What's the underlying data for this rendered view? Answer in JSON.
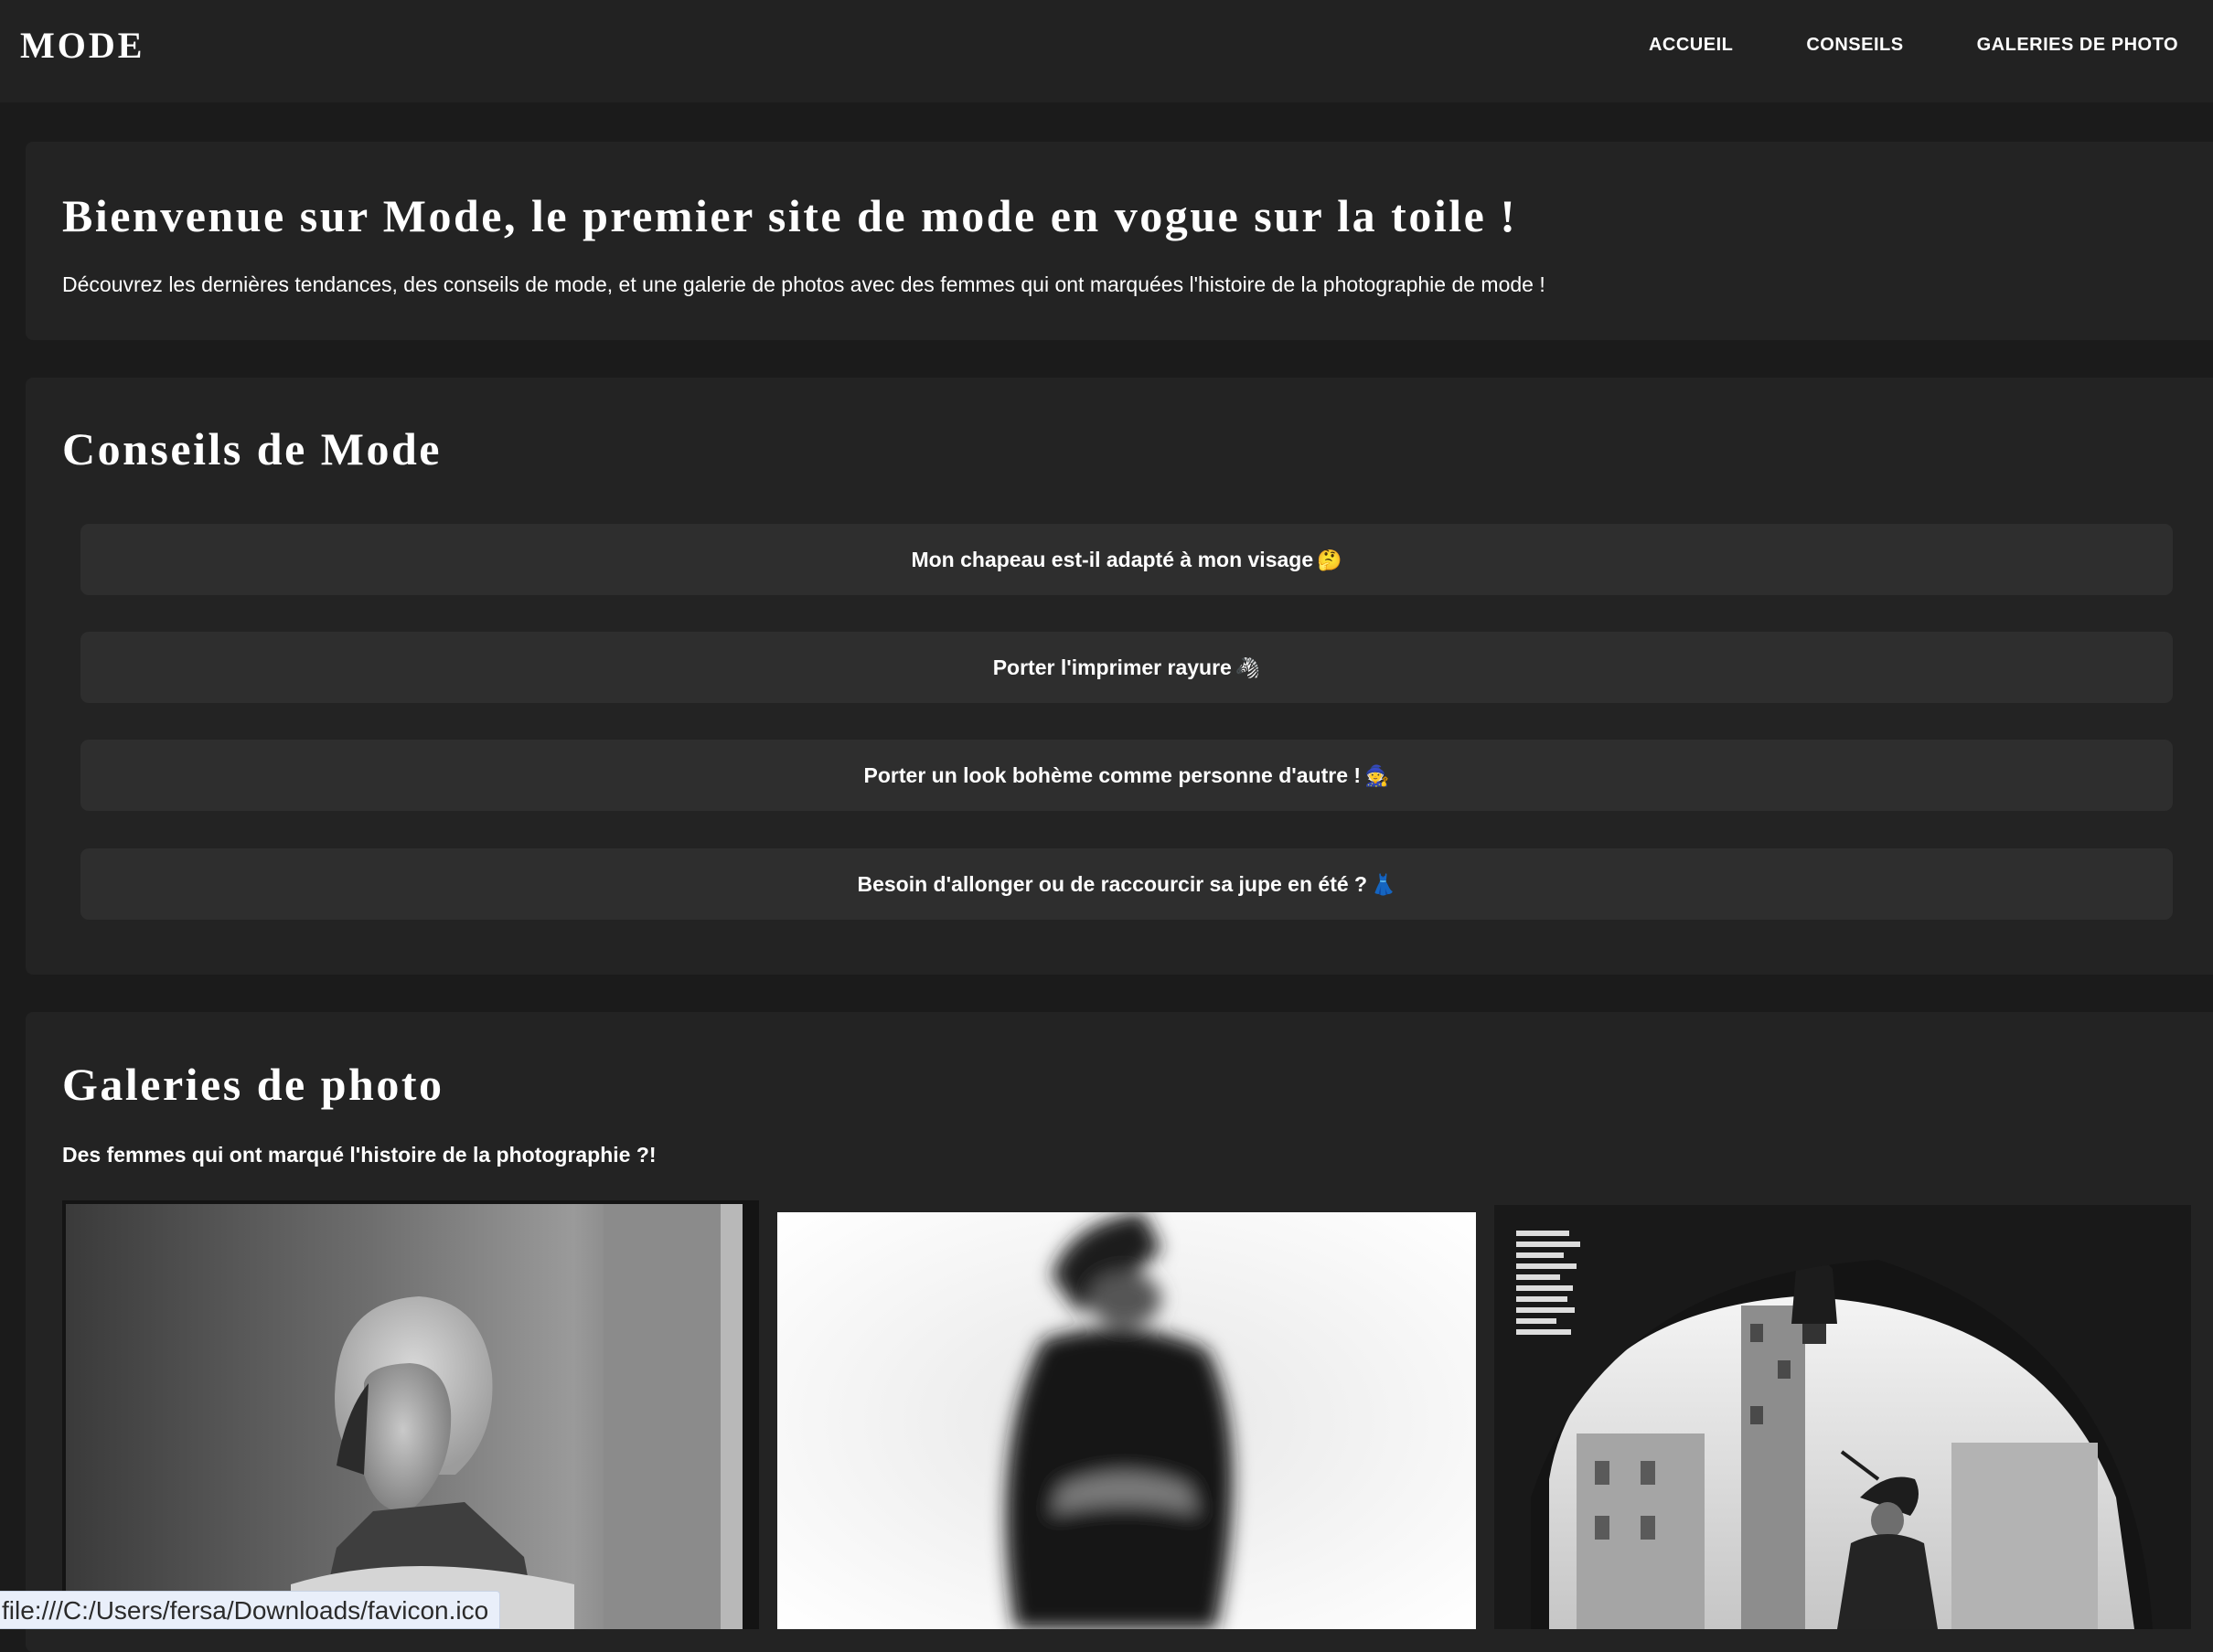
{
  "header": {
    "brand": "MODE",
    "nav": [
      "ACCUEIL",
      "CONSEILS",
      "GALERIES DE PHOTO"
    ]
  },
  "welcome": {
    "title": "Bienvenue sur Mode, le premier site de mode en vogue sur la toile !",
    "text": "Découvrez les dernières tendances, des conseils de mode, et une galerie de photos avec des femmes qui ont marquées l'histoire de la photographie de mode !"
  },
  "tips": {
    "title": "Conseils de Mode",
    "items": [
      {
        "label": "Mon chapeau est-il adapté à mon visage",
        "emoji": "🤔"
      },
      {
        "label": "Porter l'imprimer rayure",
        "emoji": "🦓"
      },
      {
        "label": "Porter un look bohème comme personne d'autre !",
        "emoji": "🧙"
      },
      {
        "label": "Besoin d'allonger ou de raccourcir sa jupe en été ?",
        "emoji": "👗"
      }
    ]
  },
  "gallery": {
    "title": "Galeries de photo",
    "subtitle": "Des femmes qui ont marqué l'histoire de la photographie ?!"
  },
  "status_bar": {
    "url": "file:///C:/Users/fersa/Downloads/favicon.ico"
  },
  "colors": {
    "page_bg": "#1b1b1b",
    "header_bg": "#222222",
    "section_bg": "#232323",
    "button_bg": "#2e2e2e",
    "text": "#ffffff",
    "status_bg": "#e9effa"
  }
}
